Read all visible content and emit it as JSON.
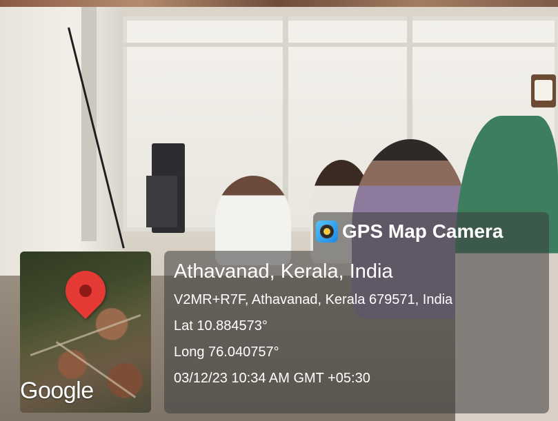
{
  "overlay": {
    "app_name": "GPS Map Camera",
    "app_icon": "gps-map-camera-icon",
    "place": "Athavanad, Kerala, India",
    "address": "V2MR+R7F, Athavanad, Kerala 679571, India",
    "latitude": "Lat 10.884573°",
    "longitude": "Long 76.040757°",
    "datetime": "03/12/23 10:34 AM GMT +05:30"
  },
  "map": {
    "provider_logo": "Google",
    "marker_icon": "location-pin-icon",
    "marker_color": "#e53935"
  },
  "colors": {
    "overlay_bg": "#3c3c3c",
    "text": "#ffffff"
  }
}
